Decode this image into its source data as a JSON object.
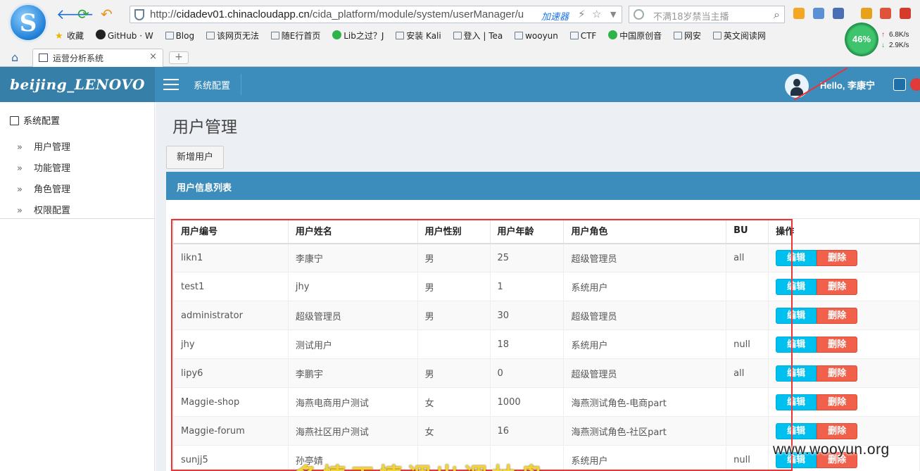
{
  "browser": {
    "url_prefix": "http://",
    "url_host": "cidadev01.chinacloudapp.cn",
    "url_path": "/cida_platform/module/system/userManager/u",
    "accelerator": "加速器",
    "search_placeholder": "不满18岁禁当主播",
    "cpu_percent": "46%",
    "upload_speed": "6.8K/s",
    "download_speed": "2.9K/s",
    "bookmarks": [
      "收藏",
      "GitHub · W",
      "Blog",
      "该网页无法",
      "随E行首页",
      "Lib之过？J",
      "安装 Kali",
      "登入 | Tea",
      "wooyun",
      "CTF",
      "中国原创音",
      "网安",
      "英文阅读网"
    ],
    "tab_title": "运营分析系统"
  },
  "app": {
    "brand": "beijing_LENOVO",
    "header_section": "系统配置",
    "hello": "Hello, 李康宁"
  },
  "sidebar": {
    "title": "系统配置",
    "items": [
      {
        "label": "用户管理"
      },
      {
        "label": "功能管理"
      },
      {
        "label": "角色管理"
      },
      {
        "label": "权限配置"
      }
    ]
  },
  "main": {
    "page_title": "用户管理",
    "add_button": "新增用户",
    "box_title": "用户信息列表",
    "columns": [
      "用户编号",
      "用户姓名",
      "用户性别",
      "用户年龄",
      "用户角色",
      "BU",
      "操作"
    ],
    "edit_label": "编辑",
    "delete_label": "删除",
    "rows": [
      {
        "id": "likn1",
        "name": "李康宁",
        "gender": "男",
        "age": "25",
        "role": "超级管理员",
        "bu": "all"
      },
      {
        "id": "test1",
        "name": "jhy",
        "gender": "男",
        "age": "1",
        "role": "系统用户",
        "bu": ""
      },
      {
        "id": "administrator",
        "name": "超级管理员",
        "gender": "男",
        "age": "30",
        "role": "超级管理员",
        "bu": ""
      },
      {
        "id": "jhy",
        "name": "测试用户",
        "gender": "",
        "age": "18",
        "role": "系统用户",
        "bu": "null"
      },
      {
        "id": "lipy6",
        "name": "李鹏宇",
        "gender": "男",
        "age": "0",
        "role": "超级管理员",
        "bu": "all"
      },
      {
        "id": "Maggie-shop",
        "name": "海燕电商用户测试",
        "gender": "女",
        "age": "1000",
        "role": "海燕测试角色-电商part",
        "bu": ""
      },
      {
        "id": "Maggie-forum",
        "name": "海燕社区用户测试",
        "gender": "女",
        "age": "16",
        "role": "海燕测试角色-社区part",
        "bu": ""
      },
      {
        "id": "sunjj5",
        "name": "孙亭婧",
        "gender": "",
        "age": "",
        "role": "系统用户",
        "bu": "null"
      }
    ]
  },
  "overlay": {
    "watermark": "www.wooyun.org",
    "caption": "多情工情调出调林盘"
  },
  "colors": {
    "header_blue": "#3c8dbc",
    "brand_blue": "#367fa9",
    "edit_cyan": "#00c0ef",
    "delete_red": "#f0604a",
    "annotation_red": "#ee3333"
  }
}
